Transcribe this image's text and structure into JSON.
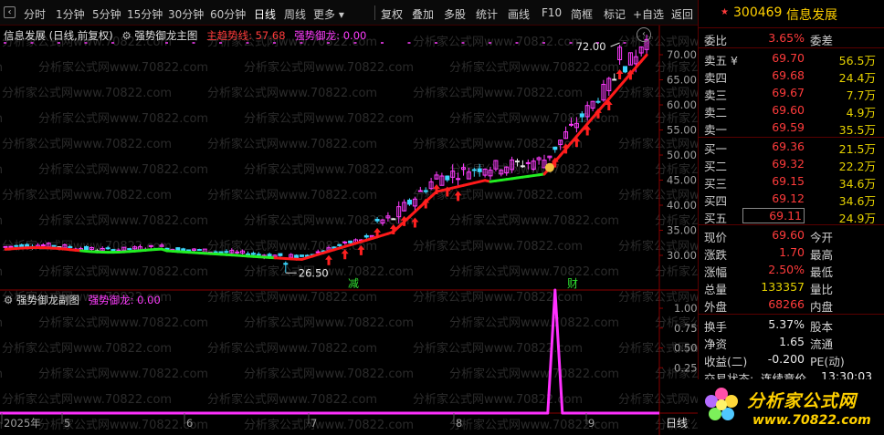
{
  "toolbar": {
    "back_glyph": "‹",
    "left_items": [
      "分时",
      "1分钟",
      "5分钟",
      "15分钟",
      "30分钟",
      "60分钟",
      "日线",
      "周线",
      "更多 ▾"
    ],
    "active_item": "日线",
    "right_items": [
      "复权",
      "叠加",
      "多股",
      "统计",
      "画线",
      "F10",
      "简框",
      "标记",
      "+自选",
      "返回"
    ]
  },
  "main_chart": {
    "legend": {
      "title": "信息发展 (日线,前复权)",
      "indicator_name": "强势御龙主图",
      "line1_label": "主趋势线: 57.68",
      "line2_label": "强势御龙: 0.00",
      "gear_icon": "gear-icon"
    },
    "y_ticks": [
      "70.00",
      "65.00",
      "60.00",
      "55.00",
      "50.00",
      "45.00",
      "40.00",
      "35.00",
      "30.00"
    ],
    "high_label": "72.00",
    "low_label": "26.50",
    "signal_labels": [
      "减",
      "财"
    ],
    "colors": {
      "up": "#ff3cff",
      "down": "#3cd7ff",
      "flat": "#e8e8e8",
      "trend_up": "#ff1a1a",
      "trend_down": "#22ee22",
      "grid": "#2a0000",
      "axis": "#8a0000"
    },
    "watermark_text": "分析家公式网www.70822.com"
  },
  "sub_chart": {
    "legend": {
      "indicator_name": "强势御龙副图",
      "line_label": "强势御龙: 0.00"
    },
    "y_ticks": [
      "1.00",
      "0.75",
      "0.50",
      "0.25"
    ],
    "x_ticks": [
      "2025年",
      "5",
      "6",
      "7",
      "8",
      "9"
    ],
    "period_label": "日线"
  },
  "chart_data": {
    "type": "line",
    "title": "",
    "xlabel": "",
    "ylabel": "",
    "ylim": [
      0,
      1.0
    ],
    "x": [
      "2025年",
      "5",
      "6",
      "7",
      "8",
      "9"
    ],
    "series": [
      {
        "name": "强势御龙",
        "values": [
          0,
          0,
          0,
          0,
          0,
          1.0,
          0,
          0
        ]
      }
    ]
  },
  "quote": {
    "code": "300469",
    "name": "信息发展",
    "star_icon": "★",
    "weibi_label": "委比",
    "weibi_value": "3.65%",
    "weicha_label": "委差",
    "asks": [
      {
        "label": "卖五 ¥",
        "price": "69.70",
        "vol": "56.5万"
      },
      {
        "label": "卖四",
        "price": "69.68",
        "vol": "24.4万"
      },
      {
        "label": "卖三",
        "price": "69.67",
        "vol": "7.7万"
      },
      {
        "label": "卖二",
        "price": "69.60",
        "vol": "4.9万"
      },
      {
        "label": "卖一",
        "price": "69.59",
        "vol": "35.5万"
      }
    ],
    "bids": [
      {
        "label": "买一",
        "price": "69.36",
        "vol": "21.5万"
      },
      {
        "label": "买二",
        "price": "69.32",
        "vol": "22.2万"
      },
      {
        "label": "买三",
        "price": "69.15",
        "vol": "34.6万"
      },
      {
        "label": "买四",
        "price": "69.12",
        "vol": "34.6万"
      },
      {
        "label": "买五",
        "price": "69.11",
        "vol": "24.9万"
      }
    ],
    "stats": [
      {
        "label": "现价",
        "value": "69.60",
        "rlabel": "今开",
        "color": "red"
      },
      {
        "label": "涨跌",
        "value": "1.70",
        "rlabel": "最高",
        "color": "red"
      },
      {
        "label": "涨幅",
        "value": "2.50%",
        "rlabel": "最低",
        "color": "red"
      },
      {
        "label": "总量",
        "value": "133357",
        "rlabel": "量比",
        "color": "yellow"
      },
      {
        "label": "外盘",
        "value": "68266",
        "rlabel": "内盘",
        "color": "red"
      }
    ],
    "stats2": [
      {
        "label": "换手",
        "value": "5.37%",
        "rlabel": "股本"
      },
      {
        "label": "净资",
        "value": "1.65",
        "rlabel": "流通"
      },
      {
        "label": "收益(二)",
        "value": "-0.200",
        "rlabel": "PE(动)"
      }
    ],
    "trade_state_label": "交易状态:",
    "trade_state_value": "连续竞价",
    "trade_time": "13:30:03"
  },
  "logo": {
    "name": "分析家公式网",
    "url": "www.70822.com"
  }
}
